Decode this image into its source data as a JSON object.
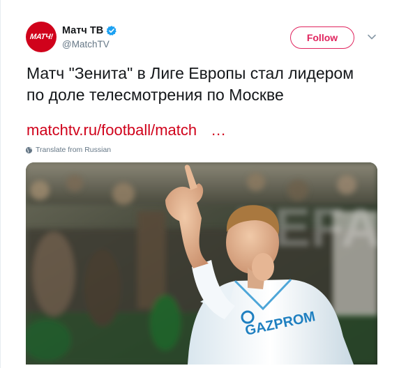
{
  "user": {
    "display_name": "Матч ТВ",
    "handle": "@MatchTV",
    "avatar_text": "МАТЧ!",
    "verified": true
  },
  "follow_button": {
    "label": "Follow"
  },
  "tweet": {
    "text": "Матч \"Зенита\" в Лиге Европы стал лидером\nпо доле телесмотрения по Москве",
    "link_text": "matchtv.ru/football/match",
    "link_ellipsis": "…",
    "translate_label": "Translate from Russian"
  },
  "media": {
    "sponsor_text": "GAZPROM",
    "banner_text": "UEFA"
  },
  "colors": {
    "brand_red": "#d0021b",
    "follow_pink": "#e0245e",
    "verified_blue": "#1da1f2",
    "secondary_text": "#657786"
  },
  "icons": {
    "verified": "verified-badge-icon",
    "caret": "chevron-down-icon",
    "translate": "globe-icon"
  }
}
